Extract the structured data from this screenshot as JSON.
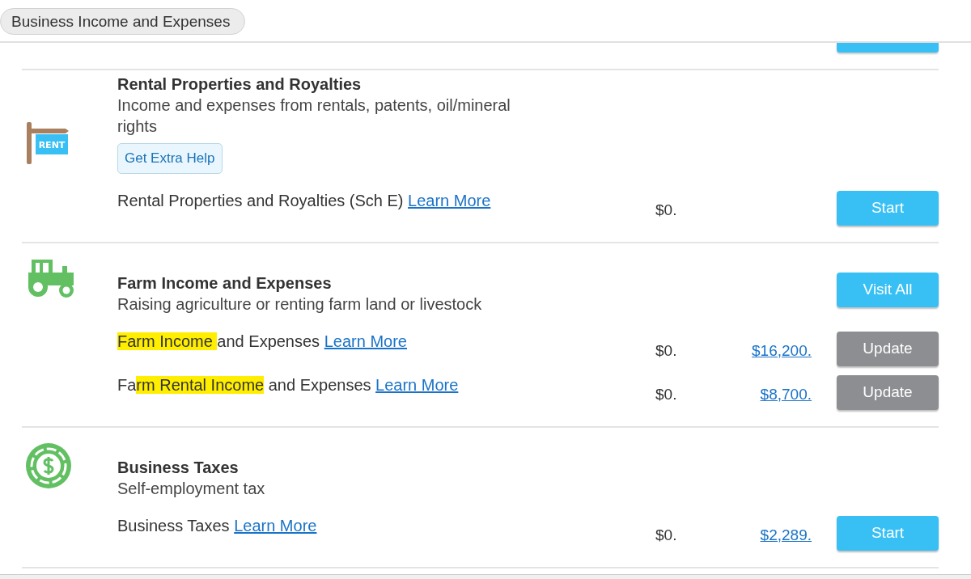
{
  "header": {
    "tab": "Business Income and Expenses"
  },
  "sections": [
    {
      "kind": "rent",
      "icon_label": "RENT",
      "title": "Rental Properties and Royalties",
      "subtitle": "Income and expenses from rentals, patents, oil/mineral rights",
      "help_button": "Get Extra Help",
      "items": [
        {
          "label": [
            {
              "text": "Rental Properties and Royalties (Sch E)",
              "highlighted": false
            }
          ],
          "link": "Learn More",
          "amount": "$0.",
          "button": {
            "label": "Start",
            "kind": "primary"
          }
        }
      ]
    },
    {
      "kind": "tractor",
      "title": "Farm Income and Expenses",
      "subtitle": "Raising agriculture or renting farm land or livestock",
      "header_button": {
        "label": "Visit All",
        "kind": "primary"
      },
      "items": [
        {
          "label": [
            {
              "text": "Farm Income ",
              "highlighted": true
            },
            {
              "text": "and Expenses",
              "highlighted": false
            }
          ],
          "link": "Learn More",
          "amount": "$0.",
          "amount_link": "$16,200.",
          "button": {
            "label": "Update",
            "kind": "secondary"
          }
        },
        {
          "label": [
            {
              "text": "Fa",
              "highlighted": false
            },
            {
              "text": "rm Rental Income",
              "highlighted": true
            },
            {
              "text": " and Expenses",
              "highlighted": false
            }
          ],
          "link": "Learn More",
          "amount": "$0.",
          "amount_link": "$8,700.",
          "button": {
            "label": "Update",
            "kind": "secondary"
          }
        }
      ]
    },
    {
      "kind": "coin",
      "title": "Business Taxes",
      "subtitle": "Self-employment tax",
      "items": [
        {
          "label": [
            {
              "text": "Business Taxes",
              "highlighted": false
            }
          ],
          "link": "Learn More",
          "amount": "$0.",
          "amount_link": "$2,289.",
          "button": {
            "label": "Start",
            "kind": "primary"
          }
        }
      ]
    }
  ]
}
